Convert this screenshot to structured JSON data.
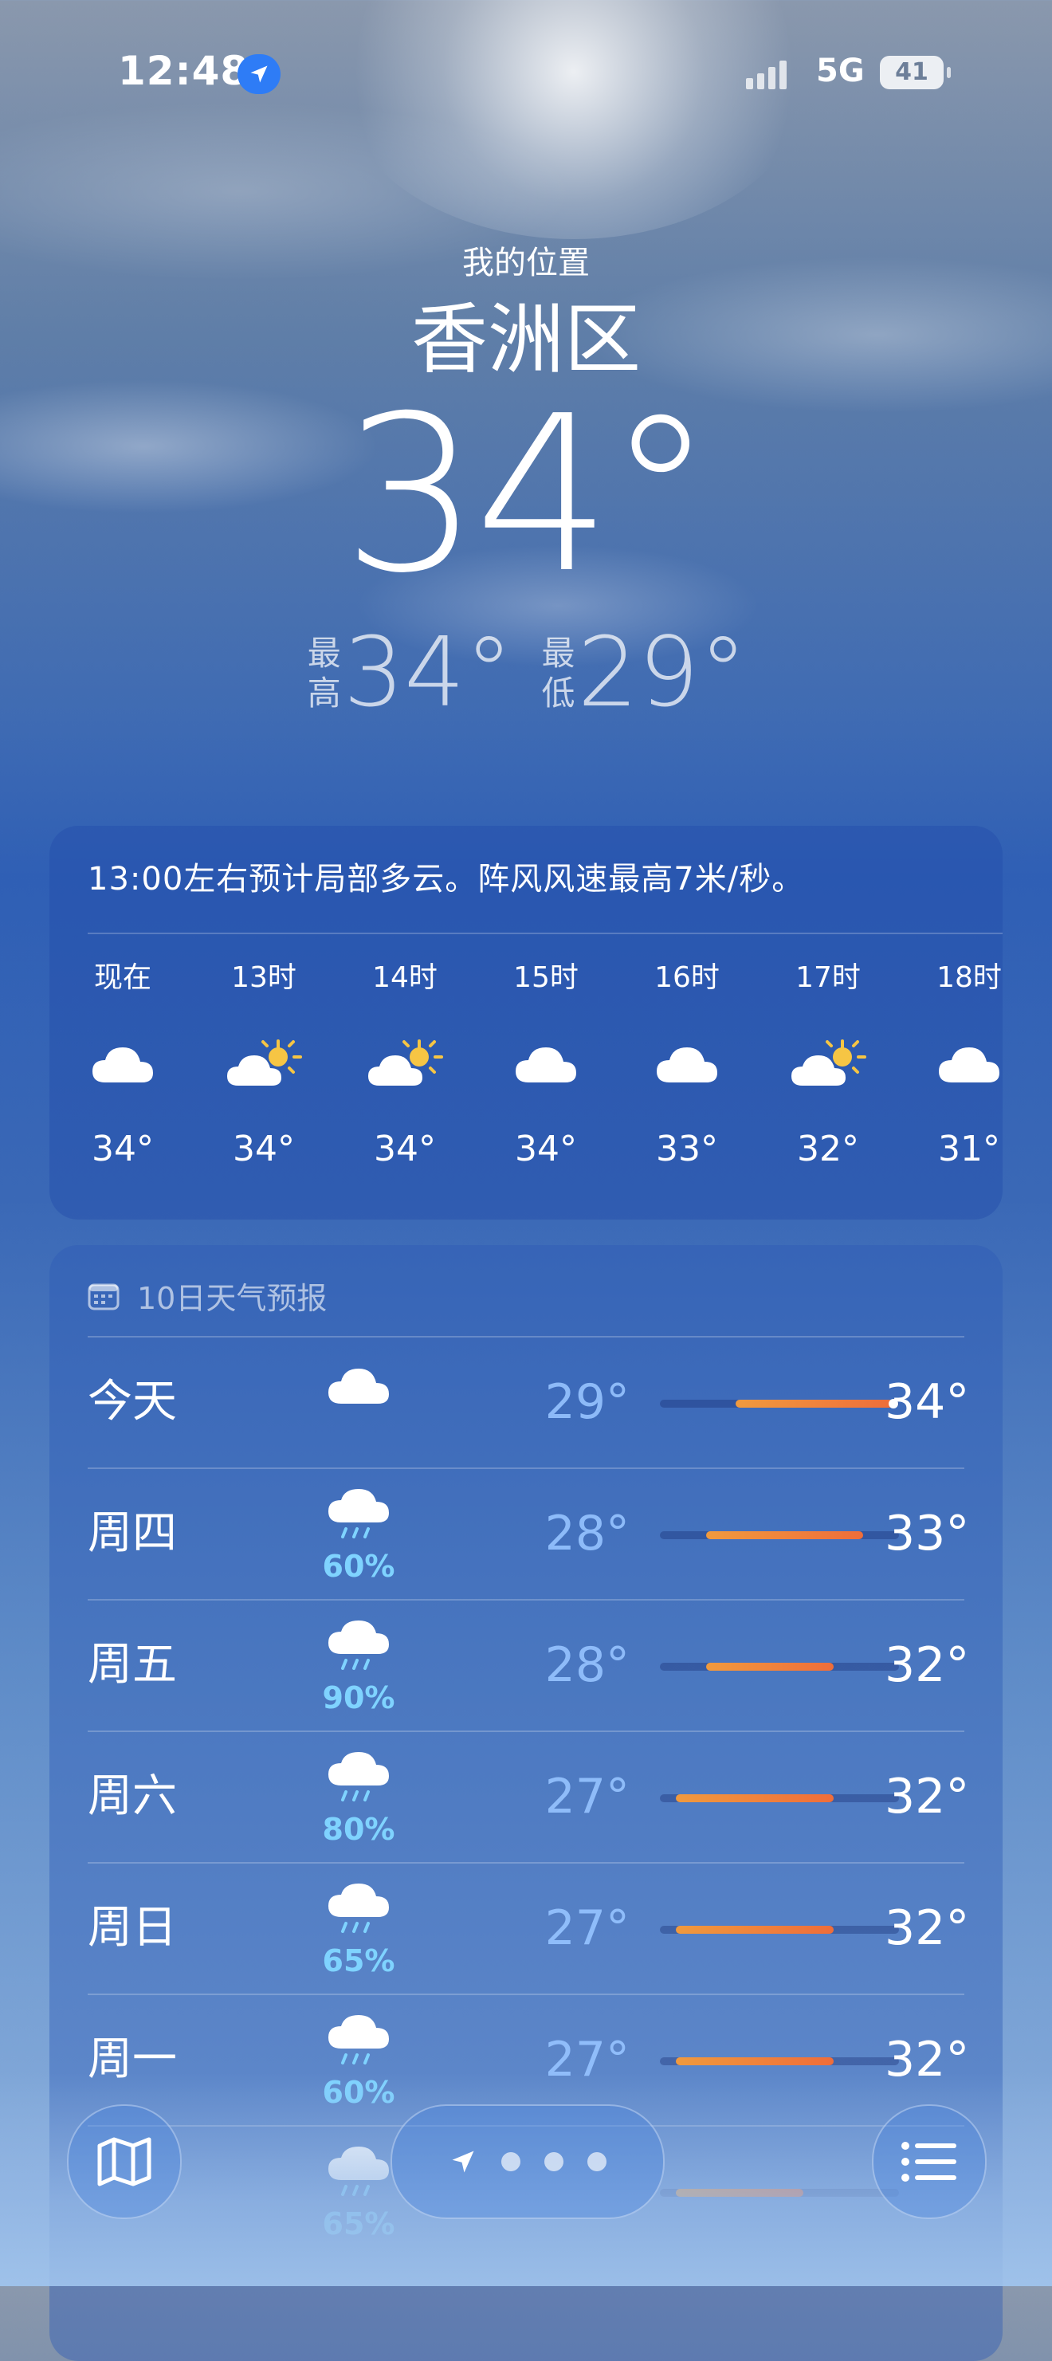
{
  "status_bar": {
    "time": "12:48",
    "network": "5G",
    "battery": "41"
  },
  "location": {
    "label": "我的位置",
    "city": "香洲区",
    "temp": "34°",
    "high_label": "最高",
    "high": "34°",
    "low_label": "最低",
    "low": "29°"
  },
  "hourly": {
    "summary": "13:00左右预计局部多云。阵风风速最高7米/秒。",
    "hours": [
      {
        "label": "现在",
        "icon": "cloud-icon",
        "temp": "34°"
      },
      {
        "label": "13时",
        "icon": "partly-sunny-icon",
        "temp": "34°"
      },
      {
        "label": "14时",
        "icon": "partly-sunny-icon",
        "temp": "34°"
      },
      {
        "label": "15时",
        "icon": "cloud-icon",
        "temp": "34°"
      },
      {
        "label": "16时",
        "icon": "cloud-icon",
        "temp": "33°"
      },
      {
        "label": "17时",
        "icon": "partly-sunny-icon",
        "temp": "32°"
      },
      {
        "label": "18时",
        "icon": "cloud-icon",
        "temp": "31°"
      }
    ]
  },
  "daily": {
    "title": "10日天气预报",
    "range_min": 27,
    "range_max": 34,
    "current_temp": 34,
    "days": [
      {
        "name": "今天",
        "icon": "cloud-icon",
        "precip": "",
        "low": "29°",
        "high": "34°",
        "low_v": 29,
        "high_v": 34,
        "current": true
      },
      {
        "name": "周四",
        "icon": "rain-icon",
        "precip": "60%",
        "low": "28°",
        "high": "33°",
        "low_v": 28,
        "high_v": 33,
        "current": false
      },
      {
        "name": "周五",
        "icon": "rain-icon",
        "precip": "90%",
        "low": "28°",
        "high": "32°",
        "low_v": 28,
        "high_v": 32,
        "current": false
      },
      {
        "name": "周六",
        "icon": "rain-icon",
        "precip": "80%",
        "low": "27°",
        "high": "32°",
        "low_v": 27,
        "high_v": 32,
        "current": false
      },
      {
        "name": "周日",
        "icon": "rain-icon",
        "precip": "65%",
        "low": "27°",
        "high": "32°",
        "low_v": 27,
        "high_v": 32,
        "current": false
      },
      {
        "name": "周一",
        "icon": "rain-icon",
        "precip": "60%",
        "low": "27°",
        "high": "32°",
        "low_v": 27,
        "high_v": 32,
        "current": false
      },
      {
        "name": "",
        "icon": "rain-icon",
        "precip": "65%",
        "low": "",
        "high": "",
        "low_v": 27,
        "high_v": 31,
        "current": false
      }
    ]
  },
  "colors": {
    "accent": "#2e7cf6",
    "temp_bar": "#ef6d3a",
    "precip": "#7fd3ff"
  },
  "toolbar": {
    "map_icon": "map-icon",
    "location_icon": "location-arrow-icon",
    "list_icon": "list-icon"
  }
}
